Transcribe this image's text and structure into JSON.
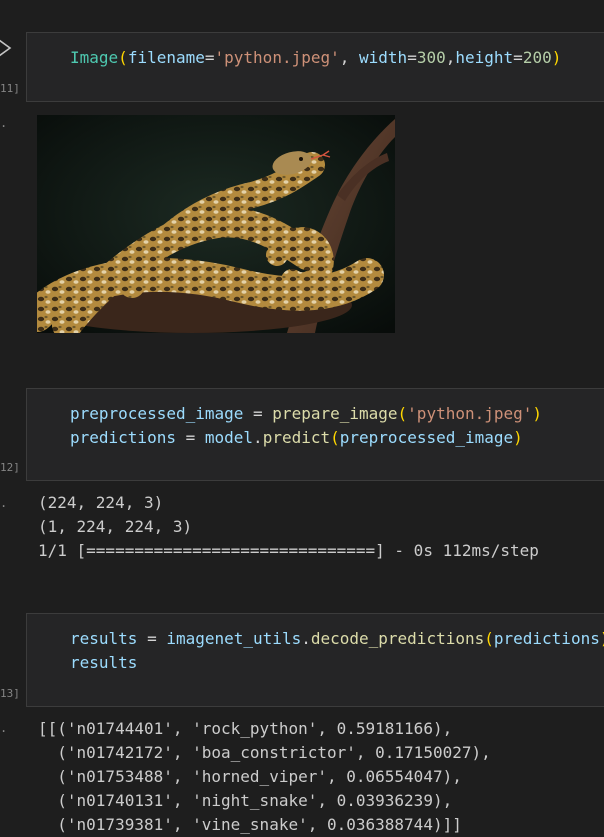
{
  "cells": [
    {
      "execution_count": "11]",
      "code": {
        "line1": {
          "fn": "Image",
          "p_open": "(",
          "kw1": "filename",
          "eq1": "=",
          "str1": "'python.jpeg'",
          "comma1": ", ",
          "kw2": "width",
          "eq2": "=",
          "num1": "300",
          "comma2": ",",
          "kw3": "height",
          "eq3": "=",
          "num2": "200",
          "p_close": ")"
        }
      },
      "output_type": "image",
      "image_alt": "python.jpeg"
    },
    {
      "execution_count": "12]",
      "code": {
        "line1": {
          "var": "preprocessed_image",
          "eq": " = ",
          "fn": "prepare_image",
          "p_open": "(",
          "str": "'python.jpeg'",
          "p_close": ")"
        },
        "line2": {
          "var": "predictions",
          "eq": " = ",
          "obj": "model",
          "dot": ".",
          "fn": "predict",
          "p_open": "(",
          "arg": "preprocessed_image",
          "p_close": ")"
        }
      },
      "output_lines": [
        "(224, 224, 3)",
        "(1, 224, 224, 3)",
        "1/1 [==============================] - 0s 112ms/step"
      ]
    },
    {
      "execution_count": "13]",
      "code": {
        "line1": {
          "var": "results",
          "eq": " = ",
          "obj": "imagenet_utils",
          "dot": ".",
          "fn": "decode_predictions",
          "p_open": "(",
          "arg": "predictions",
          "p_close": ")"
        },
        "line2": {
          "var": "results"
        }
      },
      "output_lines": [
        "[[('n01744401', 'rock_python', 0.59181166),",
        "  ('n01742172', 'boa_constrictor', 0.17150027),",
        "  ('n01753488', 'horned_viper', 0.06554047),",
        "  ('n01740131', 'night_snake', 0.03936239),",
        "  ('n01739381', 'vine_snake', 0.036388744)]]"
      ]
    }
  ],
  "icons": {
    "run": "play-triangle",
    "output_marker": "ellipsis"
  },
  "gutter": {
    "output_marker_text": "..."
  },
  "colors": {
    "background": "#1e1e1e",
    "cell_input_bg": "#252526",
    "class_name": "#4ec9b0",
    "function": "#dcdcaa",
    "variable": "#9cdcfe",
    "string": "#ce9178",
    "number": "#b5cea8",
    "bracket": "#ffd700"
  }
}
